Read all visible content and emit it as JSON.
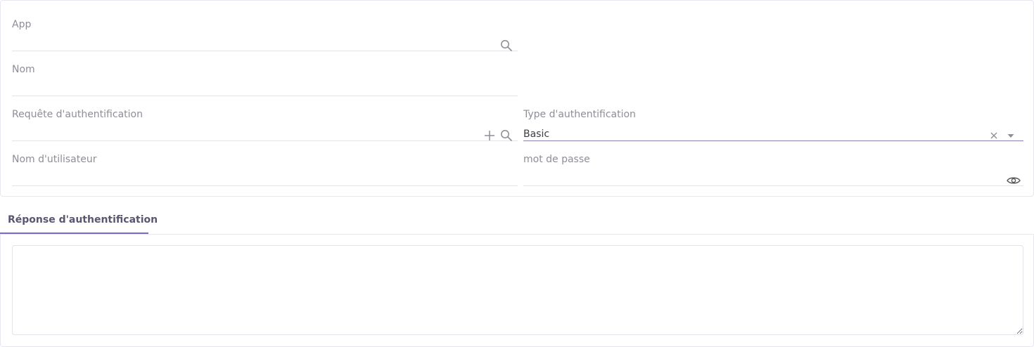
{
  "form": {
    "app": {
      "label": "App",
      "value": ""
    },
    "nom": {
      "label": "Nom",
      "value": ""
    },
    "requete": {
      "label": "Requête d'authentification",
      "value": ""
    },
    "type_auth": {
      "label": "Type d'authentification",
      "value": "Basic"
    },
    "username": {
      "label": "Nom d'utilisateur",
      "value": ""
    },
    "password": {
      "label": "mot de passe",
      "value": ""
    }
  },
  "tabs": [
    {
      "label": "Réponse d'authentification",
      "active": true
    }
  ],
  "response": {
    "value": ""
  },
  "colors": {
    "accent": "#7b6bc8",
    "label": "#8e8e96",
    "border": "#e4e4e8"
  },
  "icons": {
    "search": "search-icon",
    "add": "plus-icon",
    "clear": "close-icon",
    "dropdown": "caret-down-icon",
    "show_password": "eye-icon"
  }
}
